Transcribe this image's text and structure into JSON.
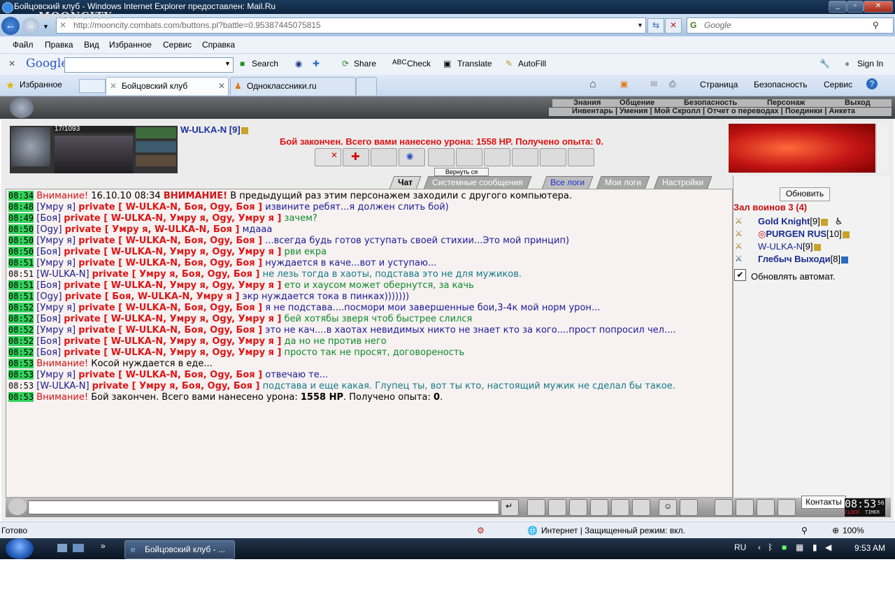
{
  "window": {
    "title": "Бойцовский клуб - Windows Internet Explorer предоставлен: Mail.Ru"
  },
  "address": {
    "url": "http://mooncity.combats.com/buttons.pl?battle=0.95387445075815",
    "search_placeholder": "Google"
  },
  "menu": [
    "Файл",
    "Правка",
    "Вид",
    "Избранное",
    "Сервис",
    "Справка"
  ],
  "google_toolbar": {
    "logo": "Google",
    "items": [
      "Search",
      "Share",
      "Check",
      "Translate",
      "AutoFill",
      "Sign In"
    ]
  },
  "tabs": {
    "favorites": "Избранное",
    "tab1": "Бойцовский клуб",
    "tab2": "Одноклассники.ru"
  },
  "ie_commands": [
    "Страница",
    "Безопасность",
    "Сервис"
  ],
  "game": {
    "logo": "MOONCITY",
    "nav_top": [
      "Знания",
      "Общение",
      "Безопасность",
      "Персонаж",
      "Выход"
    ],
    "nav_bottom": "Инвентарь | Умения | Мой Скролл | Отчет о переводах | Поединки | Анкета",
    "hp": "17/1093",
    "char_name": "W-ULKA-N [9]",
    "battle_msg": "Бой закончен. Всего вами нанесено урона: 1558 HP. Получено опыта: 0.",
    "hidden_btn": "Вернуть ся",
    "chat_tabs": [
      "Чат",
      "Системные сообщения",
      "Все логи",
      "Мои логи",
      "Настройки"
    ],
    "chat": [
      {
        "t": "08:34",
        "tg": true,
        "a": "",
        "p": "",
        "w": "Внимание!",
        "m": " 16.10.10 08:34 ",
        "w2": "ВНИМАНИЕ!",
        "m2": " В предыдущий раз этим персонажем заходили с другого компьютера.",
        "c": "plain"
      },
      {
        "t": "08:48",
        "tg": true,
        "a": "Умру я",
        "p": "private [ W-ULKA-N, Боя, Ogy, Боя ]",
        "m": "извините ребят...я должен слить бой)",
        "c": "blue"
      },
      {
        "t": "08:49",
        "tg": true,
        "a": "Боя",
        "p": "private [ W-ULKA-N, Умру я, Ogy, Умру я ]",
        "m": "зачем?",
        "c": "green"
      },
      {
        "t": "08:50",
        "tg": true,
        "a": "Ogy",
        "p": "private [ Умру я, W-ULKA-N, Боя ]",
        "m": "мдааа",
        "c": "blue"
      },
      {
        "t": "08:50",
        "tg": true,
        "a": "Умру я",
        "p": "private [ W-ULKA-N, Боя, Ogy, Боя ]",
        "m": "...всегда будь готов уступать своей стихии...Это мой принцип)",
        "c": "blue"
      },
      {
        "t": "08:50",
        "tg": true,
        "a": "Боя",
        "p": "private [ W-ULKA-N, Умру я, Ogy, Умру я ]",
        "m": "рви екра",
        "c": "green"
      },
      {
        "t": "08:51",
        "tg": true,
        "a": "Умру я",
        "p": "private [ W-ULKA-N, Боя, Ogy, Боя ]",
        "m": "нуждается в каче...вот и уступаю...",
        "c": "blue"
      },
      {
        "t": "08:51",
        "tg": false,
        "a": "W-ULKA-N",
        "p": "private [ Умру я, Боя, Ogy, Боя ]",
        "m": "не лезь тогда в хаоты, подстава это не для мужиков.",
        "c": "teal"
      },
      {
        "t": "08:51",
        "tg": true,
        "a": "Боя",
        "p": "private [ W-ULKA-N, Умру я, Ogy, Умру я ]",
        "m": "ето и хаусом может обернутся, за качь",
        "c": "green"
      },
      {
        "t": "08:51",
        "tg": true,
        "a": "Ogy",
        "p": "private [ Боя, W-ULKA-N, Умру я ]",
        "m": "экр нуждается тока в пинках)))))))",
        "c": "blue"
      },
      {
        "t": "08:52",
        "tg": true,
        "a": "Умру я",
        "p": "private [ W-ULKA-N, Боя, Ogy, Боя ]",
        "m": "я не подстава....посмори мои завершенные бои,3-4к мой норм урон...",
        "c": "blue"
      },
      {
        "t": "08:52",
        "tg": true,
        "a": "Боя",
        "p": "private [ W-ULKA-N, Умру я, Ogy, Умру я ]",
        "m": "бей хотябы зверя чтоб быстрее слился",
        "c": "green"
      },
      {
        "t": "08:52",
        "tg": true,
        "a": "Умру я",
        "p": "private [ W-ULKA-N, Боя, Ogy, Боя ]",
        "m": "это не кач....в хаотах невидимых никто не знает кто за кого....прост попросил чел....",
        "c": "blue"
      },
      {
        "t": "08:52",
        "tg": true,
        "a": "Боя",
        "p": "private [ W-ULKA-N, Умру я, Ogy, Умру я ]",
        "m": "да но не против него",
        "c": "green"
      },
      {
        "t": "08:52",
        "tg": true,
        "a": "Боя",
        "p": "private [ W-ULKA-N, Умру я, Ogy, Умру я ]",
        "m": "просто так не просят, договореность",
        "c": "green"
      },
      {
        "t": "08:53",
        "tg": true,
        "a": "",
        "p": "",
        "w": "Внимание!",
        "m": " Косой нуждается в еде...",
        "c": "plain"
      },
      {
        "t": "08:53",
        "tg": true,
        "a": "Умру я",
        "p": "private [ W-ULKA-N, Боя, Ogy, Боя ]",
        "m": "отвечаю те...",
        "c": "blue"
      },
      {
        "t": "08:53",
        "tg": false,
        "a": "W-ULKA-N",
        "p": "private [ Умру я, Боя, Ogy, Боя ]",
        "m": "подстава и еще какая. Глупец ты, вот ты кто, настоящий мужик не сделал бы такое.",
        "c": "teal"
      },
      {
        "t": "08:53",
        "tg": true,
        "a": "",
        "p": "",
        "w": "Внимание!",
        "m": " Бой закончен. Всего вами нанесено урона: ",
        "b1": "1558 HP",
        "m2": ". Получено опыта: ",
        "b2": "0",
        "m3": ".",
        "c": "plain"
      }
    ],
    "refresh": "Обновить",
    "room": "Зал воинов 3 (4)",
    "players": [
      {
        "name": "Gold Knight",
        "lvl": "[9]"
      },
      {
        "name": "PURGEN RUS",
        "lvl": "[10]"
      },
      {
        "name": "W-ULKA-N",
        "lvl": "[9]"
      },
      {
        "name": "Глебыч Выходи",
        "lvl": "[8]"
      }
    ],
    "auto_refresh": "Обновлять автомат.",
    "tooltip": "Контакты",
    "clock": "08:53",
    "clock_sec": "56",
    "clock_labels": [
      "CLOCK",
      "TIMER"
    ]
  },
  "status": {
    "left": "Готово",
    "zone": "Интернет | Защищенный режим: вкл.",
    "zoom": "100%"
  },
  "taskbar": {
    "task": "Бойцовский клуб - ...",
    "lang": "RU",
    "time": "9:53 AM"
  }
}
